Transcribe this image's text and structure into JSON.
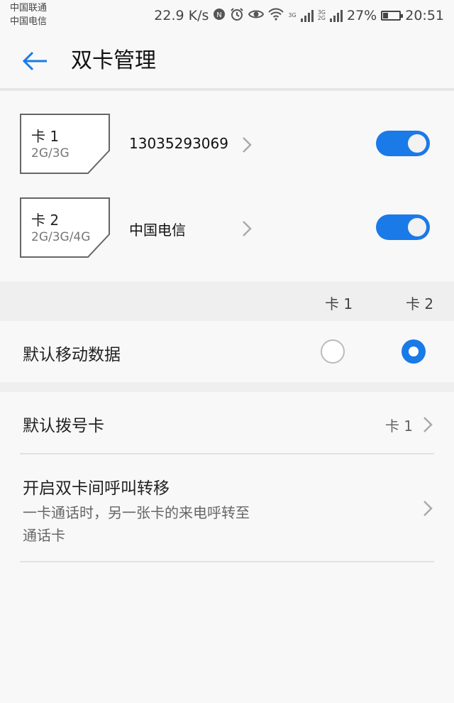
{
  "status_bar": {
    "carrier_1": "中国联通",
    "carrier_2": "中国电信",
    "speed": "22.9 K/s",
    "net_1": "3G",
    "net_2_top": "3G",
    "net_2_bottom": "2G",
    "battery": "27%",
    "time": "20:51"
  },
  "app_bar": {
    "title": "双卡管理",
    "back_icon": "arrow-left-icon",
    "accent_color": "#1a7ae8"
  },
  "sim_cards": [
    {
      "label": "卡 1",
      "networks": "2G/3G",
      "name": "13035293069",
      "enabled": true
    },
    {
      "label": "卡 2",
      "networks": "2G/3G/4G",
      "name": "中国电信",
      "enabled": true
    }
  ],
  "columns": {
    "card_1": "卡 1",
    "card_2": "卡 2"
  },
  "default_data": {
    "label": "默认移动数据",
    "selected": "卡 2"
  },
  "default_dial": {
    "label": "默认拨号卡",
    "value": "卡 1"
  },
  "call_forward": {
    "title": "开启双卡间呼叫转移",
    "description_line_1": "一卡通话时，另一张卡的来电呼转至",
    "description_line_2": "通话卡"
  }
}
